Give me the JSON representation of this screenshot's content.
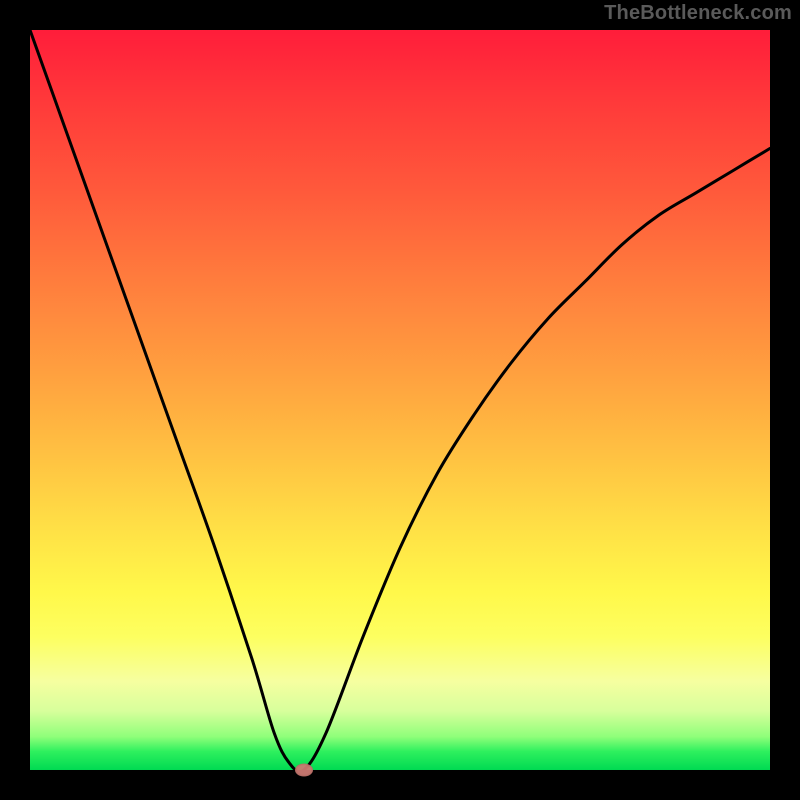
{
  "watermark": "TheBottleneck.com",
  "chart_data": {
    "type": "line",
    "title": "",
    "xlabel": "",
    "ylabel": "",
    "xlim": [
      0,
      1
    ],
    "ylim": [
      0,
      1
    ],
    "grid": false,
    "legend": false,
    "background": "vertical-gradient red→orange→yellow→green",
    "series": [
      {
        "name": "bottleneck-curve",
        "x": [
          0.0,
          0.05,
          0.1,
          0.15,
          0.2,
          0.25,
          0.3,
          0.33,
          0.35,
          0.37,
          0.4,
          0.45,
          0.5,
          0.55,
          0.6,
          0.65,
          0.7,
          0.75,
          0.8,
          0.85,
          0.9,
          0.95,
          1.0
        ],
        "y": [
          1.0,
          0.86,
          0.72,
          0.58,
          0.44,
          0.3,
          0.15,
          0.05,
          0.01,
          0.0,
          0.05,
          0.18,
          0.3,
          0.4,
          0.48,
          0.55,
          0.61,
          0.66,
          0.71,
          0.75,
          0.78,
          0.81,
          0.84
        ],
        "color": "#000000",
        "stroke_width": 3
      }
    ],
    "annotations": [
      {
        "name": "min-marker",
        "shape": "ellipse",
        "x": 0.37,
        "y": 0.0,
        "color": "#cc7a72"
      }
    ]
  }
}
